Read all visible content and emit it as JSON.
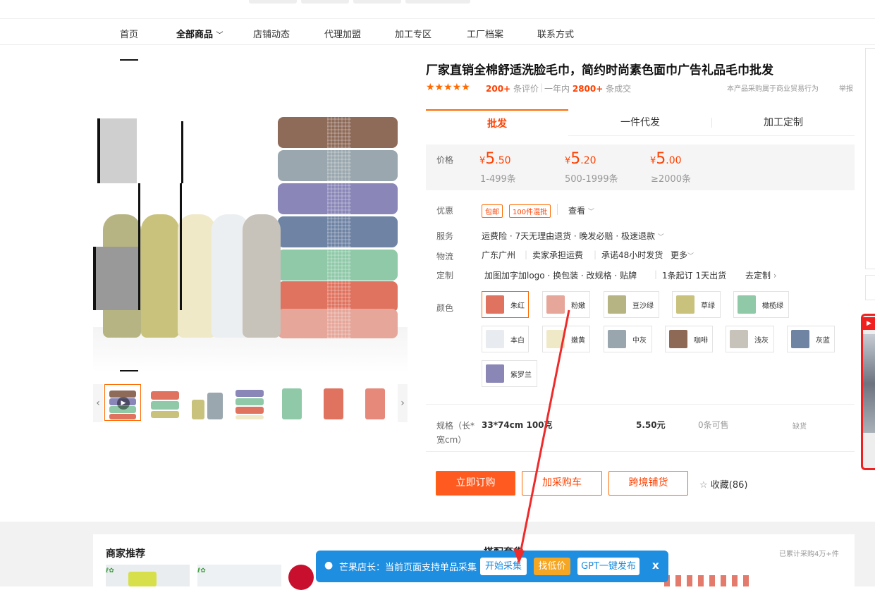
{
  "nav": {
    "items": [
      "首页",
      "全部商品",
      "店铺动态",
      "代理加盟",
      "加工专区",
      "工厂档案",
      "联系方式"
    ]
  },
  "product": {
    "title": "厂家直销全棉舒适洗脸毛巾，简约时尚素色面巾广告礼品毛巾批发",
    "stars": "★★★★★",
    "reviews_count": "200+",
    "reviews_label": "条评价",
    "year_label": "一年内",
    "sold_count": "2800+",
    "sold_label": "条成交",
    "trade_note": "本产品采购属于商业贸易行为",
    "report": "举报"
  },
  "purchase_tabs": [
    "批发",
    "一件代发",
    "加工定制"
  ],
  "price": {
    "label": "价格",
    "tiers": [
      {
        "yen": "¥",
        "int": "5",
        "dec": ".50",
        "range": "1-499条"
      },
      {
        "yen": "¥",
        "int": "5",
        "dec": ".20",
        "range": "500-1999条"
      },
      {
        "yen": "¥",
        "int": "5",
        "dec": ".00",
        "range": "≥2000条"
      }
    ]
  },
  "promo": {
    "label": "优惠",
    "tags": [
      "包邮",
      "100件混批"
    ],
    "more": "查看"
  },
  "service": {
    "label": "服务",
    "text": "运费险 · 7天无理由退货 · 晚发必赔 · 极速退款"
  },
  "logistics": {
    "label": "物流",
    "origin": "广东广州",
    "freight": "卖家承担运费",
    "ship": "承诺48小时发货",
    "more": "更多"
  },
  "custom": {
    "label": "定制",
    "text": "加图加字加logo · 换包装 · 改规格 · 贴牌",
    "moq": "1条起订 1天出货",
    "link": "去定制"
  },
  "colors": {
    "label": "颜色",
    "items": [
      {
        "name": "朱红",
        "color": "#e0735f"
      },
      {
        "name": "粉嫩",
        "color": "#e6a69a"
      },
      {
        "name": "豆沙绿",
        "color": "#b7b483"
      },
      {
        "name": "草绿",
        "color": "#c9c27c"
      },
      {
        "name": "橄榄绿",
        "color": "#8fc9a8"
      },
      {
        "name": "本白",
        "color": "#e8ebef"
      },
      {
        "name": "嫩黄",
        "color": "#efe9c8"
      },
      {
        "name": "中灰",
        "color": "#9aa6ad"
      },
      {
        "name": "咖啡",
        "color": "#8e6a56"
      },
      {
        "name": "浅灰",
        "color": "#c7c2ba"
      },
      {
        "name": "灰蓝",
        "color": "#6f84a3"
      },
      {
        "name": "紫罗兰",
        "color": "#8a86b5"
      }
    ]
  },
  "sku": {
    "label_line1": "规格（长*",
    "label_line2": "宽cm）",
    "spec": "33*74cm 100克",
    "price": "5.50元",
    "stock": "0条可售",
    "status": "缺货"
  },
  "actions": {
    "buy": "立即订购",
    "cart": "加采购车",
    "crossborder": "跨境铺货",
    "favorite": "收藏(86)"
  },
  "recommend": {
    "title": "商家推荐",
    "middle": "搭配套货",
    "sold_note": "已累计采购4万+件"
  },
  "plugin": {
    "brand": "芒果店长：当前页面支持单品采集",
    "start": "开始采集",
    "cheap": "找低价",
    "gpt": "GPT一键发布",
    "close": "x"
  }
}
